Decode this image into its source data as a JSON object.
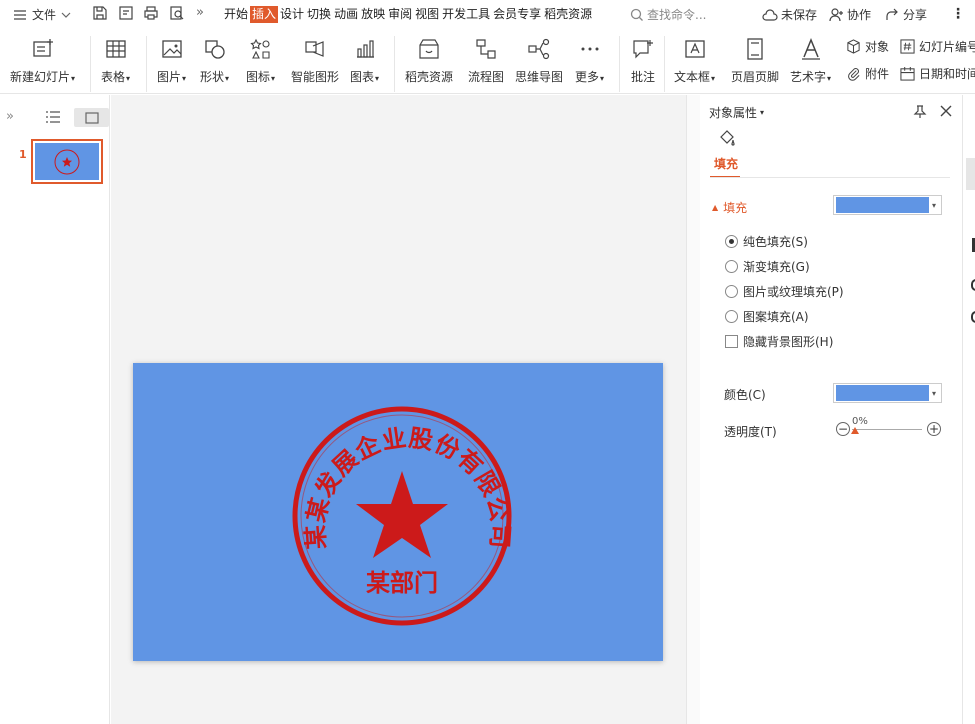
{
  "topbar": {
    "file_label": "文件",
    "tabs": [
      {
        "label": "开始"
      },
      {
        "label": "插入"
      },
      {
        "label": "设计"
      },
      {
        "label": "切换"
      },
      {
        "label": "动画"
      },
      {
        "label": "放映"
      },
      {
        "label": "审阅"
      },
      {
        "label": "视图"
      },
      {
        "label": "开发工具"
      },
      {
        "label": "会员专享"
      },
      {
        "label": "稻壳资源"
      }
    ],
    "search_placeholder": "查找命令...",
    "unsaved_label": "未保存",
    "collab_label": "协作",
    "share_label": "分享"
  },
  "toolbar": {
    "new_slide": "新建幻灯片",
    "table": "表格",
    "picture": "图片",
    "shape": "形状",
    "icon": "图标",
    "smartart": "智能图形",
    "chart": "图表",
    "docer": "稻壳资源",
    "flowchart": "流程图",
    "mindmap": "思维导图",
    "more": "更多",
    "comment": "批注",
    "textbox": "文本框",
    "header_footer": "页眉页脚",
    "wordart": "艺术字",
    "object": "对象",
    "attachment": "附件",
    "slide_number": "幻灯片编号",
    "datetime": "日期和时间"
  },
  "slides_panel": {
    "slide_number": "1"
  },
  "slide": {
    "stamp_ring_text": "某某发展企业股份有限公司",
    "stamp_bottom_text": "某部门"
  },
  "properties": {
    "title": "对象属性",
    "tab_fill": "填充",
    "section_fill": "填充",
    "options": [
      {
        "label": "纯色填充(S)",
        "checked": true
      },
      {
        "label": "渐变填充(G)",
        "checked": false
      },
      {
        "label": "图片或纹理填充(P)",
        "checked": false
      },
      {
        "label": "图案填充(A)",
        "checked": false
      }
    ],
    "hide_bg_label": "隐藏背景图形(H)",
    "color_label": "颜色(C)",
    "transparency_label": "透明度(T)",
    "transparency_value": "0%",
    "fill_color": "#6095e4"
  },
  "colors": {
    "accent": "#e05a2c",
    "slide_bg": "#6095e4",
    "stamp_red": "#cc1a1a"
  }
}
